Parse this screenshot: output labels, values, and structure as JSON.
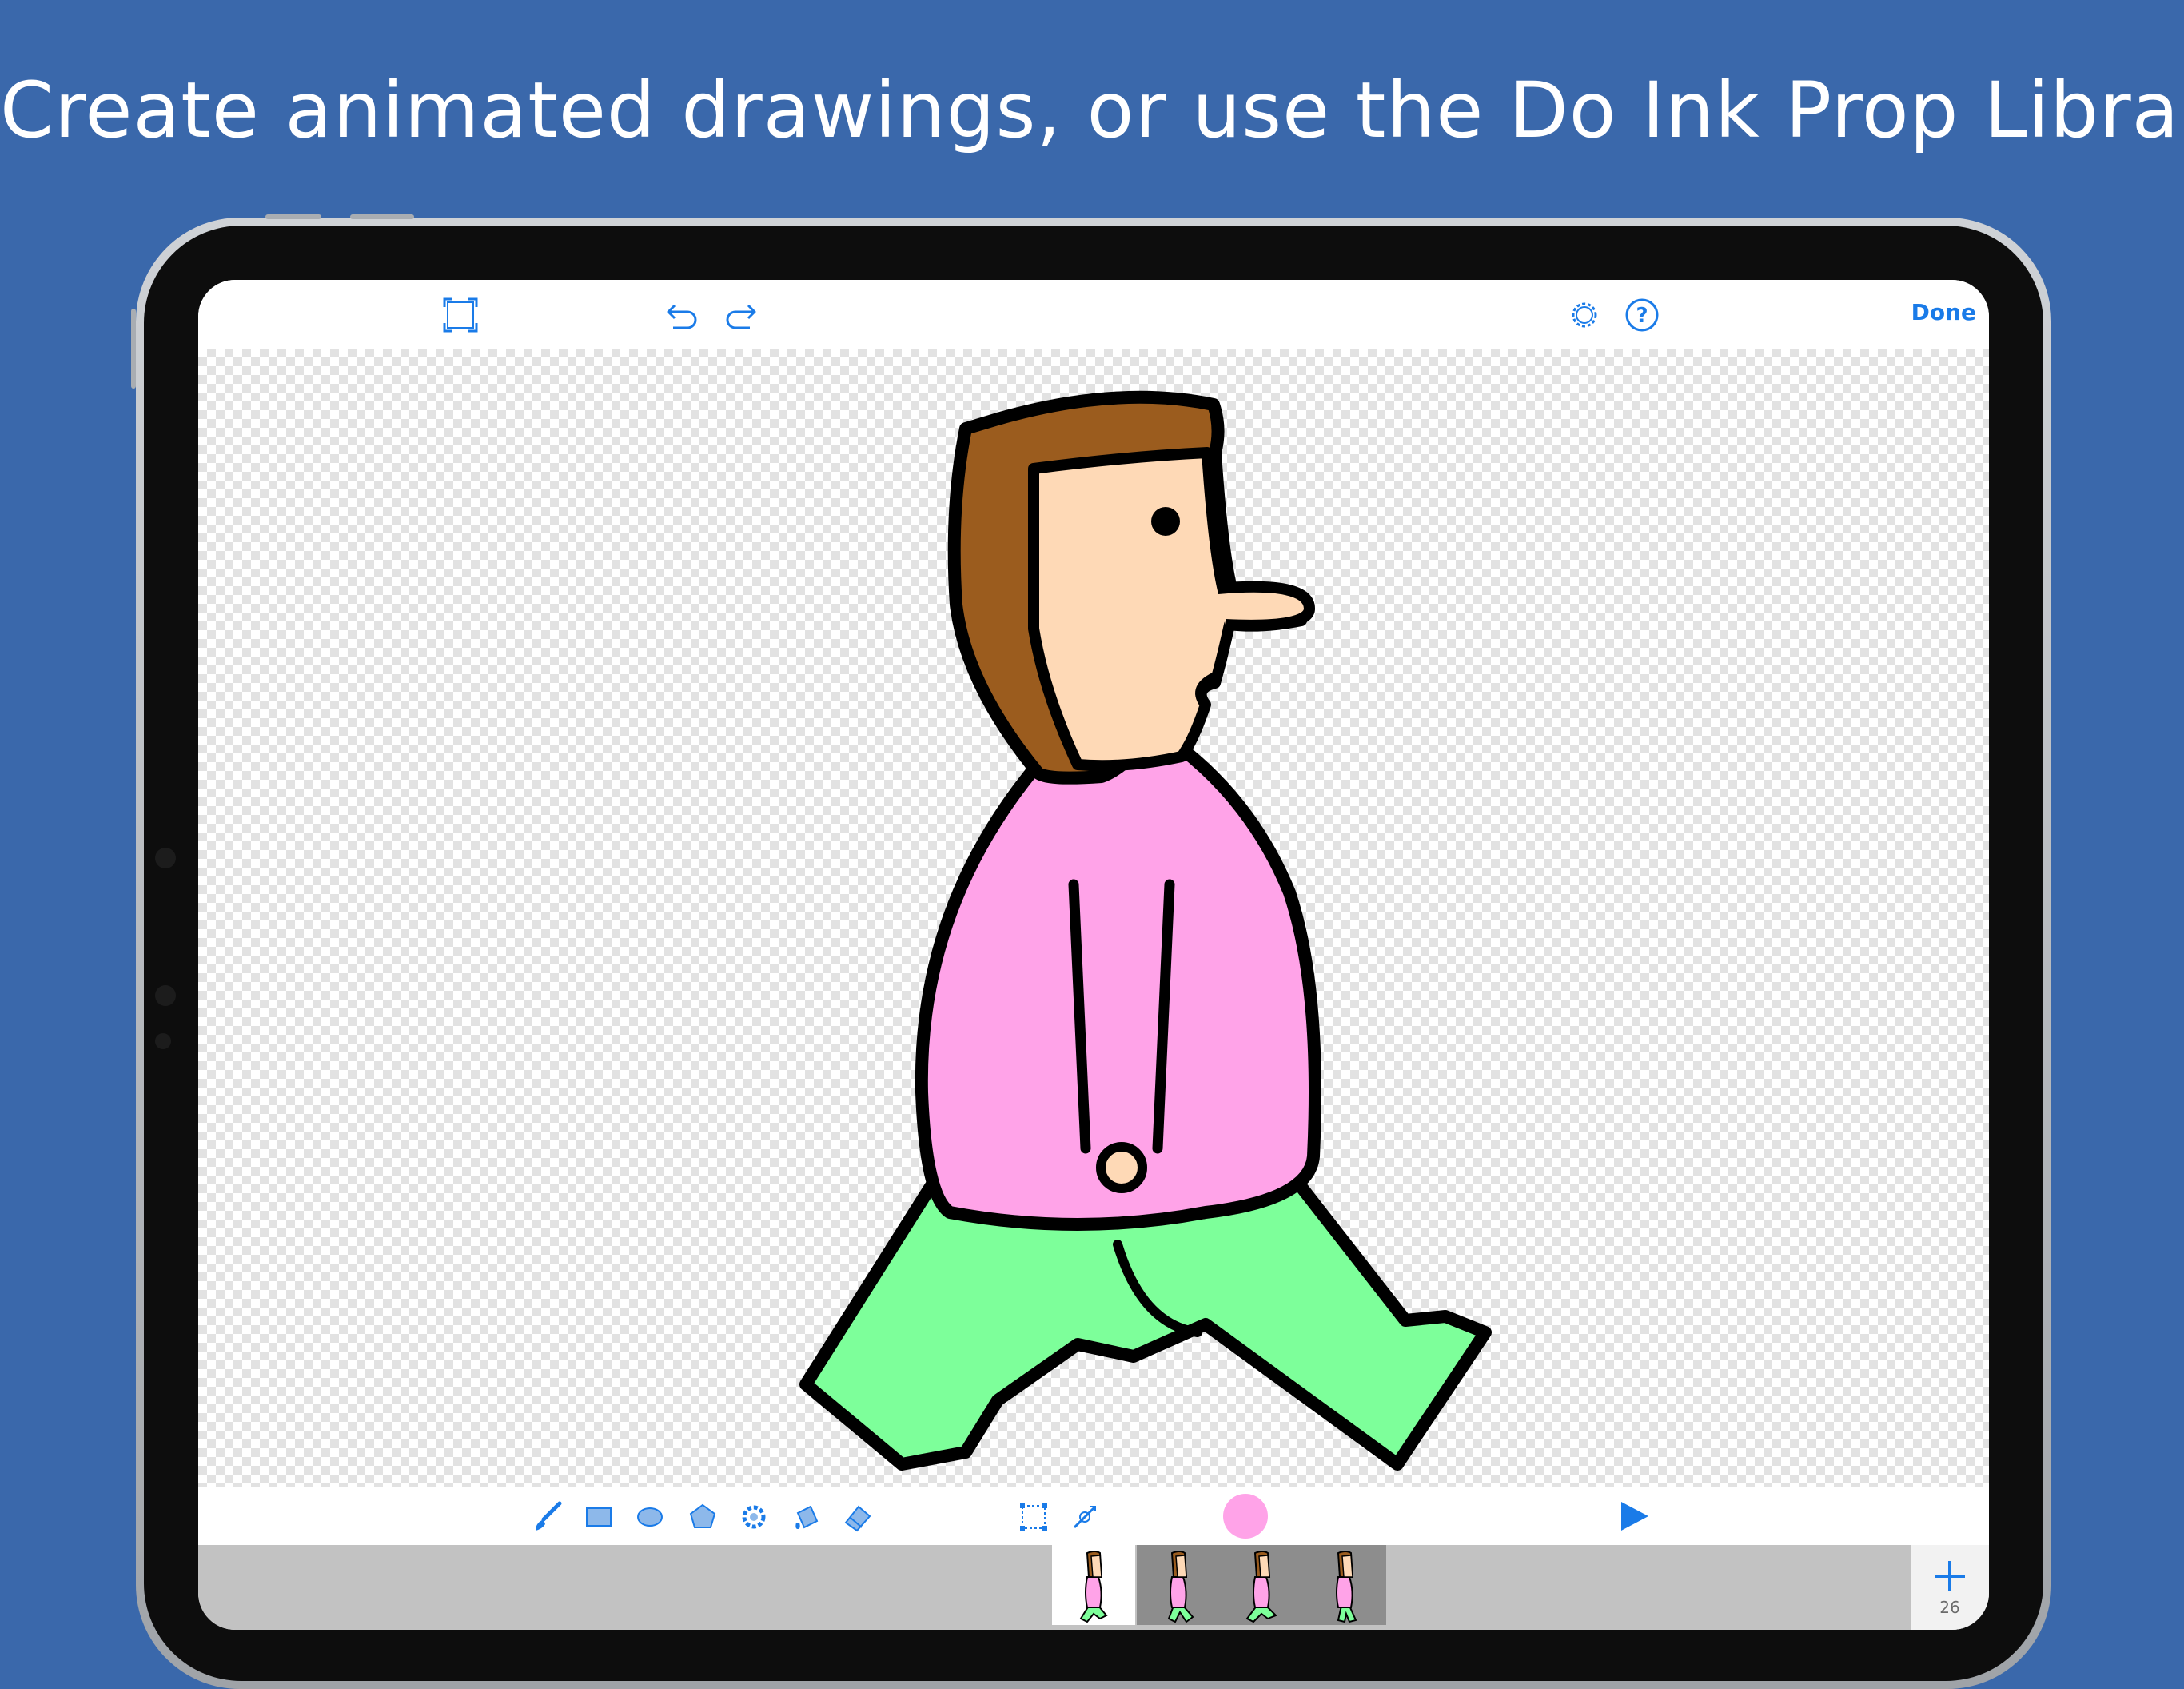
{
  "headline": "Create animated drawings, or use the Do Ink Prop Library.",
  "colors": {
    "background": "#3a68ab",
    "accent": "#1a7be8",
    "current_color": "#ffa3e8",
    "hair": "#9b5c1e",
    "skin": "#fed9b6",
    "shirt": "#ffa3e8",
    "pants": "#7dff9a"
  },
  "toolbar": {
    "fullscreen_icon": "fullscreen-icon",
    "undo_icon": "undo-icon",
    "redo_icon": "redo-icon",
    "settings_icon": "gear-icon",
    "help_icon": "help-icon",
    "done_label": "Done"
  },
  "tools": [
    {
      "name": "brush-icon",
      "label": "Brush"
    },
    {
      "name": "rectangle-icon",
      "label": "Rectangle"
    },
    {
      "name": "ellipse-icon",
      "label": "Ellipse"
    },
    {
      "name": "polygon-icon",
      "label": "Polygon"
    },
    {
      "name": "shape-fill-icon",
      "label": "Shapes"
    },
    {
      "name": "paint-bucket-icon",
      "label": "Fill"
    },
    {
      "name": "eraser-icon",
      "label": "Eraser"
    },
    {
      "name": "selection-icon",
      "label": "Select"
    },
    {
      "name": "transform-icon",
      "label": "Transform"
    }
  ],
  "timeline": {
    "frames": [
      {
        "id": 1,
        "selected": true
      },
      {
        "id": 2,
        "selected": false
      },
      {
        "id": 3,
        "selected": false
      },
      {
        "id": 4,
        "selected": false
      }
    ],
    "add_icon": "plus-icon",
    "frame_count": "26"
  }
}
